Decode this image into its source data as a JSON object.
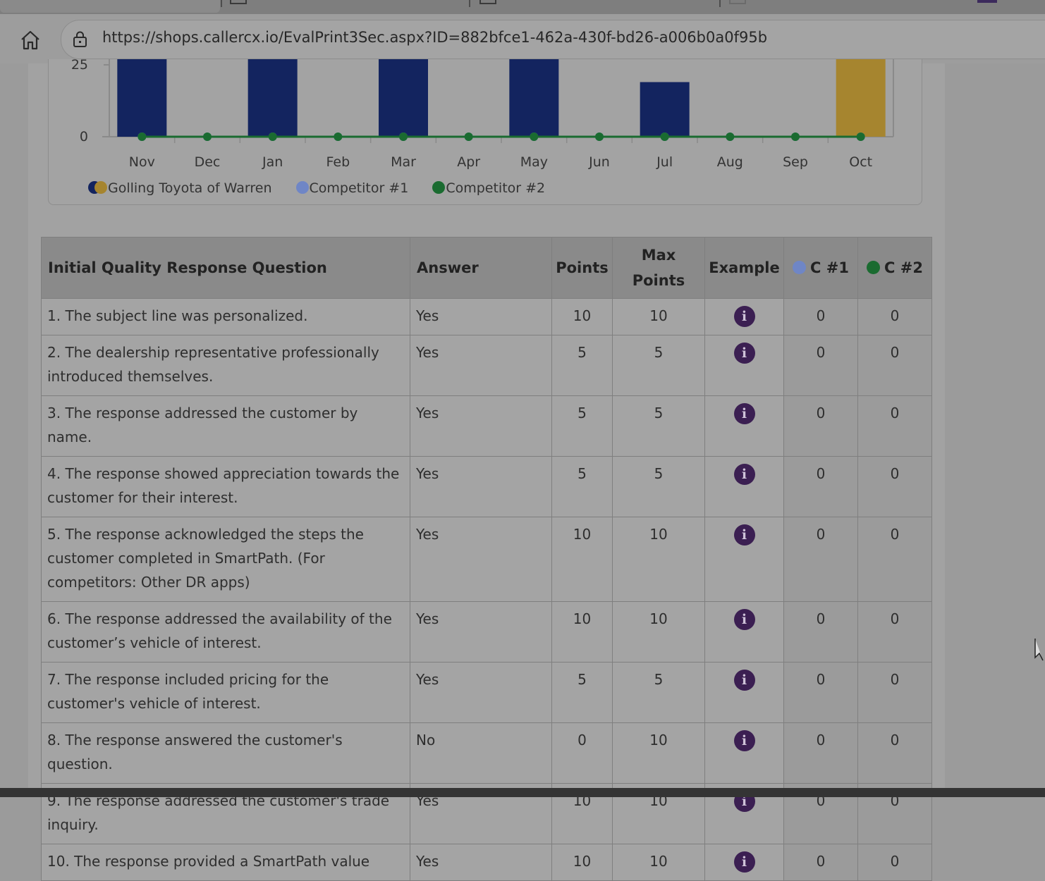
{
  "browser": {
    "url": "https://shops.callercx.io/EvalPrint3Sec.aspx?ID=882bfce1-462a-430f-bd26-a006b0a0f95b"
  },
  "chart_data": {
    "type": "bar",
    "categories": [
      "Nov",
      "Dec",
      "Jan",
      "Feb",
      "Mar",
      "Apr",
      "May",
      "Jun",
      "Jul",
      "Aug",
      "Sep",
      "Oct"
    ],
    "ylim": [
      0,
      27
    ],
    "yticks": [
      0,
      25
    ],
    "ytick_labels": [
      "0",
      "25"
    ],
    "series": [
      {
        "name": "Golling Toyota of Warren",
        "kind": "bar",
        "values": [
          30,
          0,
          30,
          0,
          30,
          0,
          30,
          0,
          19,
          0,
          0,
          30
        ],
        "highlight_index": 11,
        "color": "#13245f",
        "highlight_color": "#a6852f"
      },
      {
        "name": "Competitor #1",
        "kind": "line",
        "values": [
          0,
          0,
          0,
          0,
          0,
          0,
          0,
          0,
          0,
          0,
          0,
          0
        ],
        "color": "#6f86c6"
      },
      {
        "name": "Competitor #2",
        "kind": "line",
        "values": [
          0,
          0,
          0,
          0,
          0,
          0,
          0,
          0,
          0,
          0,
          0,
          0
        ],
        "color": "#1a6b30"
      }
    ],
    "legend_position": "bottom-left"
  },
  "legend": [
    {
      "label": "Golling Toyota of Warren",
      "colors": [
        "#13245f",
        "#a6852f"
      ]
    },
    {
      "label": "Competitor #1",
      "colors": [
        "#6f86c6"
      ]
    },
    {
      "label": "Competitor #2",
      "colors": [
        "#1a6b30"
      ]
    }
  ],
  "table": {
    "headers": {
      "question": "Initial Quality Response Question",
      "answer": "Answer",
      "points": "Points",
      "max_points": "Max Points",
      "example": "Example",
      "c1": "C #1",
      "c2": "C #2"
    },
    "rows": [
      {
        "question": "1. The subject line was personalized.",
        "answer": "Yes",
        "points": "10",
        "max": "10",
        "c1": "0",
        "c2": "0"
      },
      {
        "question": "2. The dealership representative professionally introduced themselves.",
        "answer": "Yes",
        "points": "5",
        "max": "5",
        "c1": "0",
        "c2": "0"
      },
      {
        "question": "3. The response addressed the customer by name.",
        "answer": "Yes",
        "points": "5",
        "max": "5",
        "c1": "0",
        "c2": "0"
      },
      {
        "question": "4. The response showed appreciation towards the customer for their interest.",
        "answer": "Yes",
        "points": "5",
        "max": "5",
        "c1": "0",
        "c2": "0"
      },
      {
        "question": "5. The response acknowledged the steps the customer completed in SmartPath. (For competitors: Other DR apps)",
        "answer": "Yes",
        "points": "10",
        "max": "10",
        "c1": "0",
        "c2": "0"
      },
      {
        "question": "6. The response addressed the availability of the customer’s vehicle of interest.",
        "answer": "Yes",
        "points": "10",
        "max": "10",
        "c1": "0",
        "c2": "0"
      },
      {
        "question": "7. The response included pricing for the customer's vehicle of interest.",
        "answer": "Yes",
        "points": "5",
        "max": "5",
        "c1": "0",
        "c2": "0"
      },
      {
        "question": "8. The response answered the customer's question.",
        "answer": "No",
        "points": "0",
        "max": "10",
        "c1": "0",
        "c2": "0"
      },
      {
        "question": "9. The response addressed the customer's trade inquiry.",
        "answer": "Yes",
        "points": "10",
        "max": "10",
        "c1": "0",
        "c2": "0"
      },
      {
        "question": "10. The response provided a SmartPath value",
        "answer": "Yes",
        "points": "10",
        "max": "10",
        "c1": "0",
        "c2": "0"
      }
    ],
    "example_icon": "info-icon",
    "example_glyph": "i",
    "c1_color": "#6f86c6",
    "c2_color": "#1a6b30"
  }
}
